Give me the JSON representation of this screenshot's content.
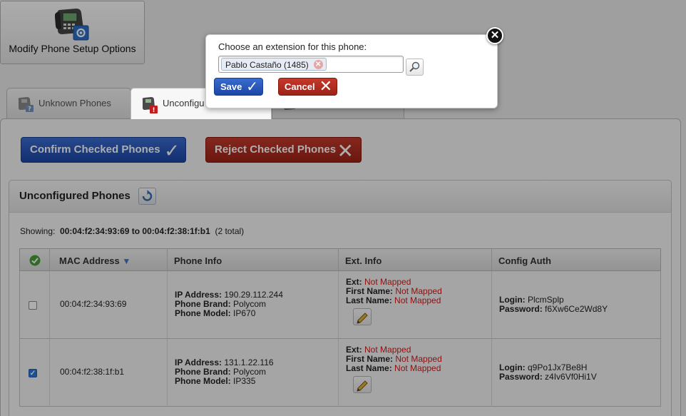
{
  "setup_button": {
    "label": "Modify Phone Setup Options",
    "icon": "phone-settings-icon"
  },
  "tabs": [
    {
      "label": "Unknown Phones",
      "icon": "phone-unknown-icon"
    },
    {
      "label": "Unconfigu",
      "icon": "phone-alert-icon",
      "active": true
    },
    {
      "label": "",
      "icon": "phone-icon"
    }
  ],
  "actions": {
    "confirm_label": "Confirm Checked Phones",
    "reject_label": "Reject Checked Phones"
  },
  "panel": {
    "title": "Unconfigured Phones",
    "showing_label": "Showing:",
    "showing_range": "00:04:f2:34:93:69 to 00:04:f2:38:1f:b1",
    "showing_total": "(2 total)"
  },
  "table": {
    "headers": {
      "mac": "MAC Address",
      "phone_info": "Phone Info",
      "ext_info": "Ext. Info",
      "config_auth": "Config Auth"
    },
    "labels": {
      "ip": "IP Address:",
      "brand": "Phone Brand:",
      "model": "Phone Model:",
      "ext": "Ext:",
      "first": "First Name:",
      "last": "Last Name:",
      "login": "Login:",
      "password": "Password:"
    },
    "rows": [
      {
        "checked": false,
        "mac": "00:04:f2:34:93:69",
        "ip": "190.29.112.244",
        "brand": "Polycom",
        "model": "IP670",
        "ext": "Not Mapped",
        "first": "Not Mapped",
        "last": "Not Mapped",
        "login": "PlcmSplp",
        "password": "f6Xw6Ce2Wd8Y"
      },
      {
        "checked": true,
        "mac": "00:04:f2:38:1f:b1",
        "ip": "131.1.22.116",
        "brand": "Polycom",
        "model": "IP335",
        "ext": "Not Mapped",
        "first": "Not Mapped",
        "last": "Not Mapped",
        "login": "q9Po1Jx7Be8H",
        "password": "z4Iv6Vf0Hi1V"
      }
    ]
  },
  "dialog": {
    "prompt": "Choose an extension for this phone:",
    "selected_token": "Pablo Castaño  (1485)",
    "save_label": "Save",
    "cancel_label": "Cancel"
  },
  "colors": {
    "primary_blue": "#1c46a6",
    "danger_red": "#9d2318",
    "not_mapped_red": "#d01b1b"
  }
}
